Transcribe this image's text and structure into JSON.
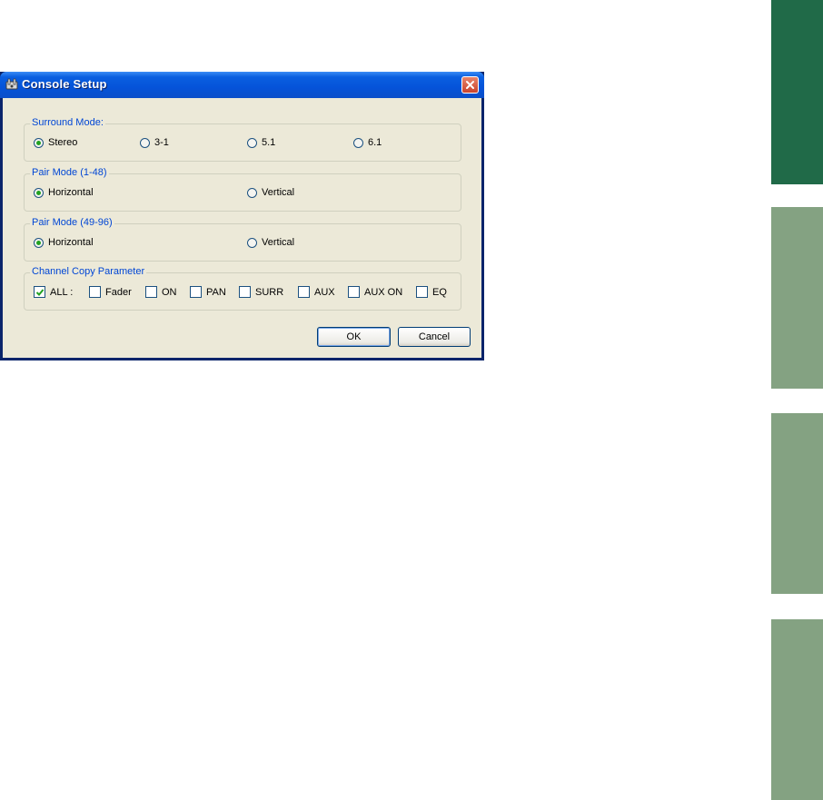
{
  "side_tabs": {
    "colors": [
      "#206a48",
      "#84a282",
      "#84a282",
      "#84a282"
    ]
  },
  "dialog": {
    "title": "Console Setup",
    "icon": "console-app-icon",
    "close_icon": "close-icon"
  },
  "surround_mode": {
    "label": "Surround Mode:",
    "options": [
      "Stereo",
      "3-1",
      "5.1",
      "6.1"
    ],
    "selected": "Stereo"
  },
  "pair_mode_1": {
    "label": "Pair Mode (1-48)",
    "options": [
      "Horizontal",
      "Vertical"
    ],
    "selected": "Horizontal"
  },
  "pair_mode_2": {
    "label": "Pair Mode (49-96)",
    "options": [
      "Horizontal",
      "Vertical"
    ],
    "selected": "Horizontal"
  },
  "channel_copy": {
    "label": "Channel Copy Parameter",
    "items": [
      {
        "label": "ALL :",
        "checked": true
      },
      {
        "label": "Fader",
        "checked": false
      },
      {
        "label": "ON",
        "checked": false
      },
      {
        "label": "PAN",
        "checked": false
      },
      {
        "label": "SURR",
        "checked": false
      },
      {
        "label": "AUX",
        "checked": false
      },
      {
        "label": "AUX ON",
        "checked": false
      },
      {
        "label": "EQ",
        "checked": false
      }
    ]
  },
  "buttons": {
    "ok": "OK",
    "cancel": "Cancel"
  },
  "colors": {
    "accent_dark_green": "#206a48",
    "accent_light_green": "#84a282",
    "group_label_blue": "#0046d5",
    "dialog_face": "#ece9d8",
    "titlebar_blue": "#0553d9"
  }
}
